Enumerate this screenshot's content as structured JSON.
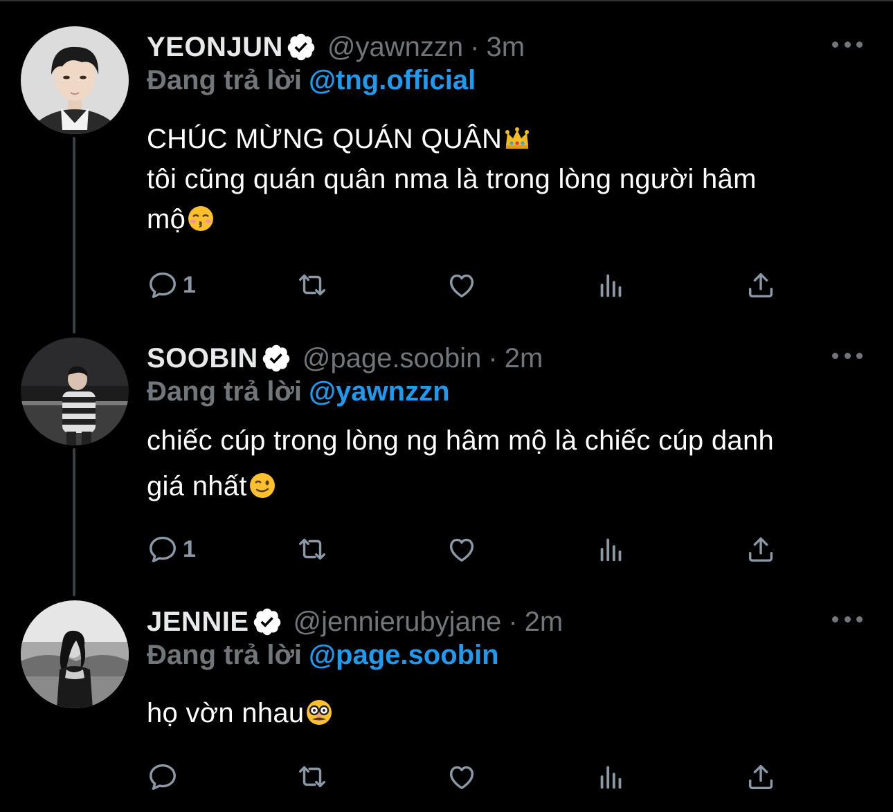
{
  "tweets": [
    {
      "name": "YEONJUN",
      "handle": "@yawnzzn",
      "time": "3m",
      "replying_label": "Đang trả lời",
      "replying_to": "@tng.official",
      "lines": [
        "CHÚC MỪNG QUÁN QUÂN",
        "tôi cũng quán quân nma là trong lòng người hâm",
        "mộ"
      ],
      "emoji_icons": [
        "crown-emoji",
        "kissing-emoji"
      ],
      "reply_count": "1",
      "verified": true
    },
    {
      "name": "SOOBIN",
      "handle": "@page.soobin",
      "time": "2m",
      "replying_label": "Đang trả lời",
      "replying_to": "@yawnzzn",
      "lines": [
        "chiếc cúp trong lòng ng hâm mộ là chiếc cúp danh",
        "giá nhất"
      ],
      "emoji_icons": [
        "wink-emoji"
      ],
      "reply_count": "1",
      "verified": true
    },
    {
      "name": "JENNIE",
      "handle": "@jennierubyjane",
      "time": "2m",
      "replying_label": "Đang trả lời",
      "replying_to": "@page.soobin",
      "lines": [
        "họ vờn nhau"
      ],
      "emoji_icons": [
        "disguise-emoji"
      ],
      "reply_count": "",
      "verified": true
    }
  ],
  "separator": "·",
  "icons": [
    "reply-icon",
    "retweet-icon",
    "like-icon",
    "analytics-icon",
    "share-icon",
    "more-icon",
    "verified-badge-icon"
  ],
  "colors": {
    "background": "#000000",
    "text": "#ffffff",
    "secondary": "#71767b",
    "accent": "#1d9bf0",
    "thread_line": "#3a3f44"
  }
}
